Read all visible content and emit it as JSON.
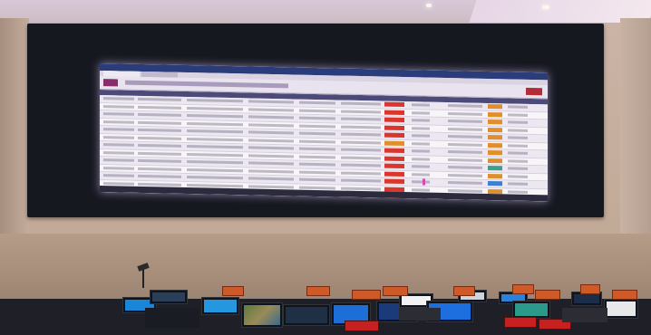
{
  "scene": {
    "subject": "",
    "colors": {
      "wall": "#c4ab9b",
      "bezel": "#161820",
      "screen": "#f4f0f6",
      "status_red": "#d9372d",
      "status_orange": "#e08f2c",
      "status_teal": "#37a38a",
      "status_blue": "#3f7fd0",
      "placard": "#d05a25"
    }
  }
}
